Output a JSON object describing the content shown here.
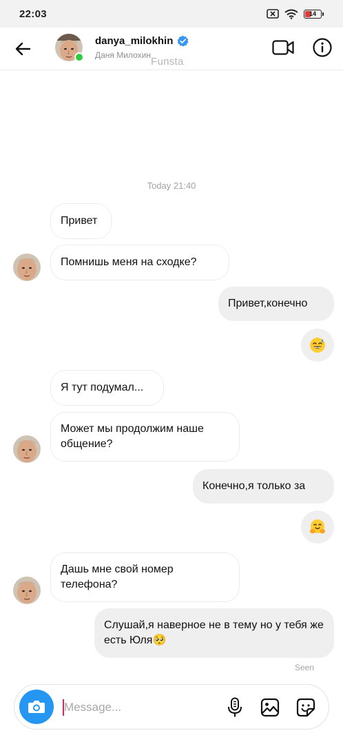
{
  "status_bar": {
    "time": "22:03",
    "battery_level": "14",
    "icons": [
      "sim-off-icon",
      "wifi-icon",
      "battery-icon"
    ]
  },
  "header": {
    "username": "danya_milokhin",
    "full_name": "Даня Милохин",
    "watermark": "Funsta",
    "verified": true,
    "online": true
  },
  "chat": {
    "timestamp": "Today 21:40",
    "messages": [
      {
        "from": "them",
        "text": "Привет"
      },
      {
        "from": "them",
        "text": "Помнишь меня на сходке?"
      },
      {
        "from": "me",
        "text": "Привет,конечно"
      },
      {
        "from": "me",
        "emoji": "😅"
      },
      {
        "from": "them",
        "text": "Я тут подумал..."
      },
      {
        "from": "them",
        "text": "Может мы продолжим наше общение?"
      },
      {
        "from": "me",
        "text": "Конечно,я только за"
      },
      {
        "from": "me",
        "emoji": "🤗"
      },
      {
        "from": "them",
        "text": "Дашь мне свой номер телефона?"
      },
      {
        "from": "me",
        "text": "Слушай,я наверное не в тему но у тебя же есть Юля🥺"
      }
    ],
    "seen_label": "Seen"
  },
  "composer": {
    "placeholder": "Message...",
    "value": ""
  },
  "colors": {
    "accent_blue": "#2597f2",
    "verified_blue": "#3897f0",
    "online_green": "#2ecc40",
    "bubble_out": "#efefef",
    "battery_low": "#e53935"
  }
}
